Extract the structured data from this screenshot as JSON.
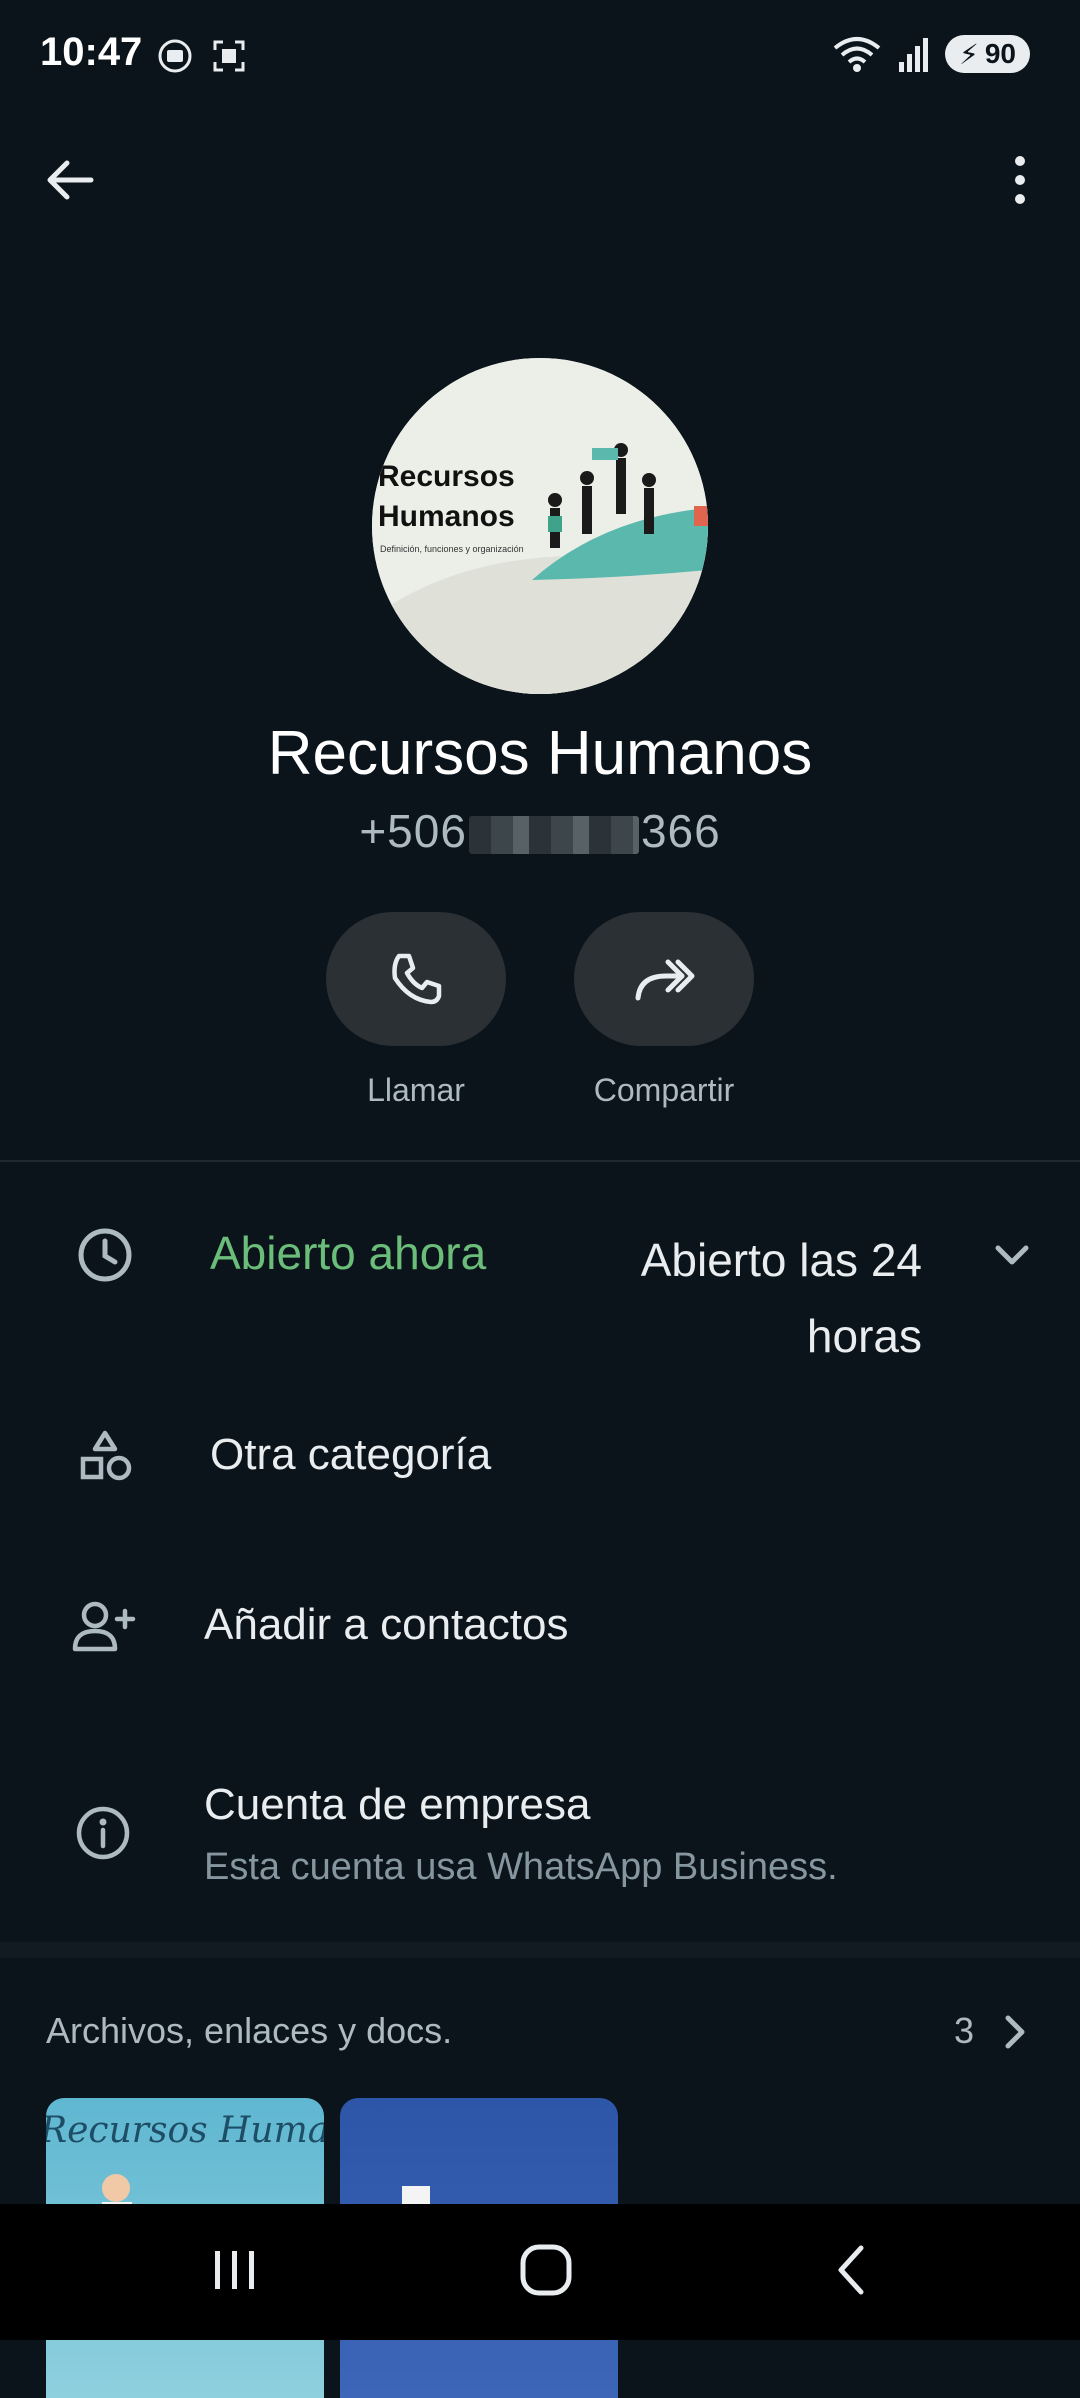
{
  "status_bar": {
    "time": "10:47",
    "battery": "90"
  },
  "contact": {
    "avatar_title_line1": "Recursos",
    "avatar_title_line2": "Humanos",
    "avatar_subtitle": "Definición, funciones y organización",
    "name": "Recursos Humanos",
    "phone_prefix": "+506",
    "phone_suffix": "366"
  },
  "actions": [
    {
      "label": "Llamar",
      "icon": "phone-icon"
    },
    {
      "label": "Compartir",
      "icon": "share-icon"
    }
  ],
  "hours": {
    "status": "Abierto ahora",
    "value_line1": "Abierto las 24",
    "value_line2": "horas"
  },
  "category": {
    "label": "Otra categoría",
    "icon": "shapes-icon"
  },
  "add_contact": {
    "label": "Añadir a contactos",
    "icon": "add-person-icon"
  },
  "business": {
    "title": "Cuenta de empresa",
    "subtitle": "Esta cuenta usa WhatsApp Business.",
    "icon": "info-icon"
  },
  "media": {
    "title": "Archivos, enlaces y docs.",
    "count": "3",
    "thumb1_text": "Recursos Humanos"
  },
  "colors": {
    "background": "#0b141a",
    "accent_green": "#6bbd7a",
    "button_bg": "#2a3033",
    "muted_text": "#aebac1"
  }
}
